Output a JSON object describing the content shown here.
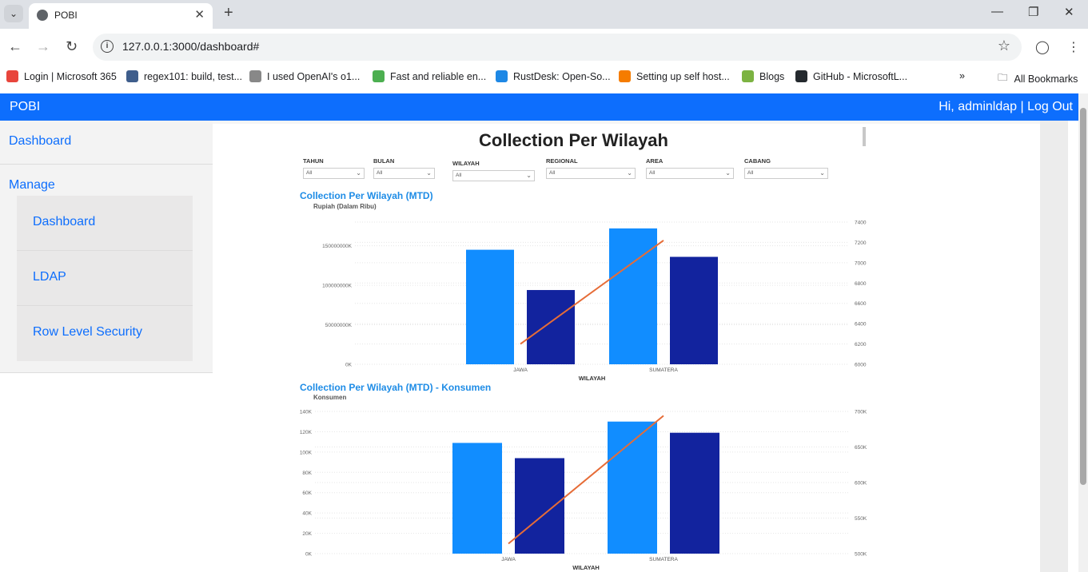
{
  "browser": {
    "tab_title": "POBI",
    "url": "127.0.0.1:3000/dashboard#",
    "bookmarks": [
      {
        "label": "Login | Microsoft 365",
        "color": "#e8453c"
      },
      {
        "label": "regex101: build, test...",
        "color": "#3f5e8c"
      },
      {
        "label": "I used OpenAI's o1...",
        "color": "#888888"
      },
      {
        "label": "Fast and reliable en...",
        "color": "#4caf50"
      },
      {
        "label": "RustDesk: Open-So...",
        "color": "#1e88e5"
      },
      {
        "label": "Setting up self host...",
        "color": "#f57c00"
      },
      {
        "label": "Blogs",
        "color": "#7cb342"
      },
      {
        "label": "GitHub - MicrosoftL...",
        "color": "#24292e"
      }
    ],
    "more_label": "»",
    "all_bookmarks": "All Bookmarks"
  },
  "app": {
    "brand": "POBI",
    "user_greeting": "Hi, adminldap | Log Out"
  },
  "sidebar": {
    "dashboard": "Dashboard",
    "manage": "Manage",
    "sub_items": [
      "Dashboard",
      "LDAP",
      "Row Level Security"
    ]
  },
  "report": {
    "title": "Collection Per Wilayah",
    "filters": [
      {
        "label": "TAHUN",
        "value": "All"
      },
      {
        "label": "BULAN",
        "value": "All"
      },
      {
        "label": "WILAYAH",
        "value": "All"
      },
      {
        "label": "REGIONAL",
        "value": "All"
      },
      {
        "label": "AREA",
        "value": "All"
      },
      {
        "label": "CABANG",
        "value": "All"
      }
    ],
    "chart1_title": "Collection Per Wilayah (MTD)",
    "chart1_sub": "Rupiah (Dalam Ribu)",
    "chart2_title": "Collection Per Wilayah (MTD) - Konsumen",
    "chart2_sub": "Konsumen"
  },
  "chart_data": [
    {
      "type": "bar",
      "title": "Collection Per Wilayah (MTD)",
      "ylabel": "Rupiah (Dalam Ribu)",
      "xlabel": "WILAYAH",
      "categories": [
        "JAWA",
        "SUMATERA"
      ],
      "series": [
        {
          "values": [
            145000000,
            172000000
          ],
          "color": "#118dff"
        },
        {
          "values": [
            94000000,
            136000000
          ],
          "color": "#12239e"
        }
      ],
      "line": {
        "values": [
          6200,
          7220
        ],
        "color": "#e66c37",
        "axis": "right"
      },
      "ylim": [
        0,
        180000000
      ],
      "yticks": [
        "0K",
        "50000000K",
        "100000000K",
        "150000000K"
      ],
      "yticks_values": [
        0,
        50000000,
        100000000,
        150000000
      ],
      "y2lim": [
        6000,
        7400
      ],
      "y2ticks": [
        "6000",
        "6200",
        "6400",
        "6600",
        "6800",
        "7000",
        "7200",
        "7400"
      ],
      "grid": true
    },
    {
      "type": "bar",
      "title": "Collection Per Wilayah (MTD) - Konsumen",
      "ylabel": "Konsumen",
      "xlabel": "WILAYAH",
      "categories": [
        "JAWA",
        "SUMATERA"
      ],
      "series": [
        {
          "values": [
            109000,
            130000
          ],
          "color": "#118dff"
        },
        {
          "values": [
            94000,
            119000
          ],
          "color": "#12239e"
        }
      ],
      "line": {
        "values": [
          514000,
          694000
        ],
        "color": "#e66c37",
        "axis": "right"
      },
      "ylim": [
        0,
        140000
      ],
      "yticks": [
        "0K",
        "20K",
        "40K",
        "60K",
        "80K",
        "100K",
        "120K",
        "140K"
      ],
      "yticks_values": [
        0,
        20000,
        40000,
        60000,
        80000,
        100000,
        120000,
        140000
      ],
      "y2lim": [
        500000,
        700000
      ],
      "y2ticks": [
        "500K",
        "550K",
        "600K",
        "650K",
        "700K"
      ],
      "grid": true
    }
  ]
}
